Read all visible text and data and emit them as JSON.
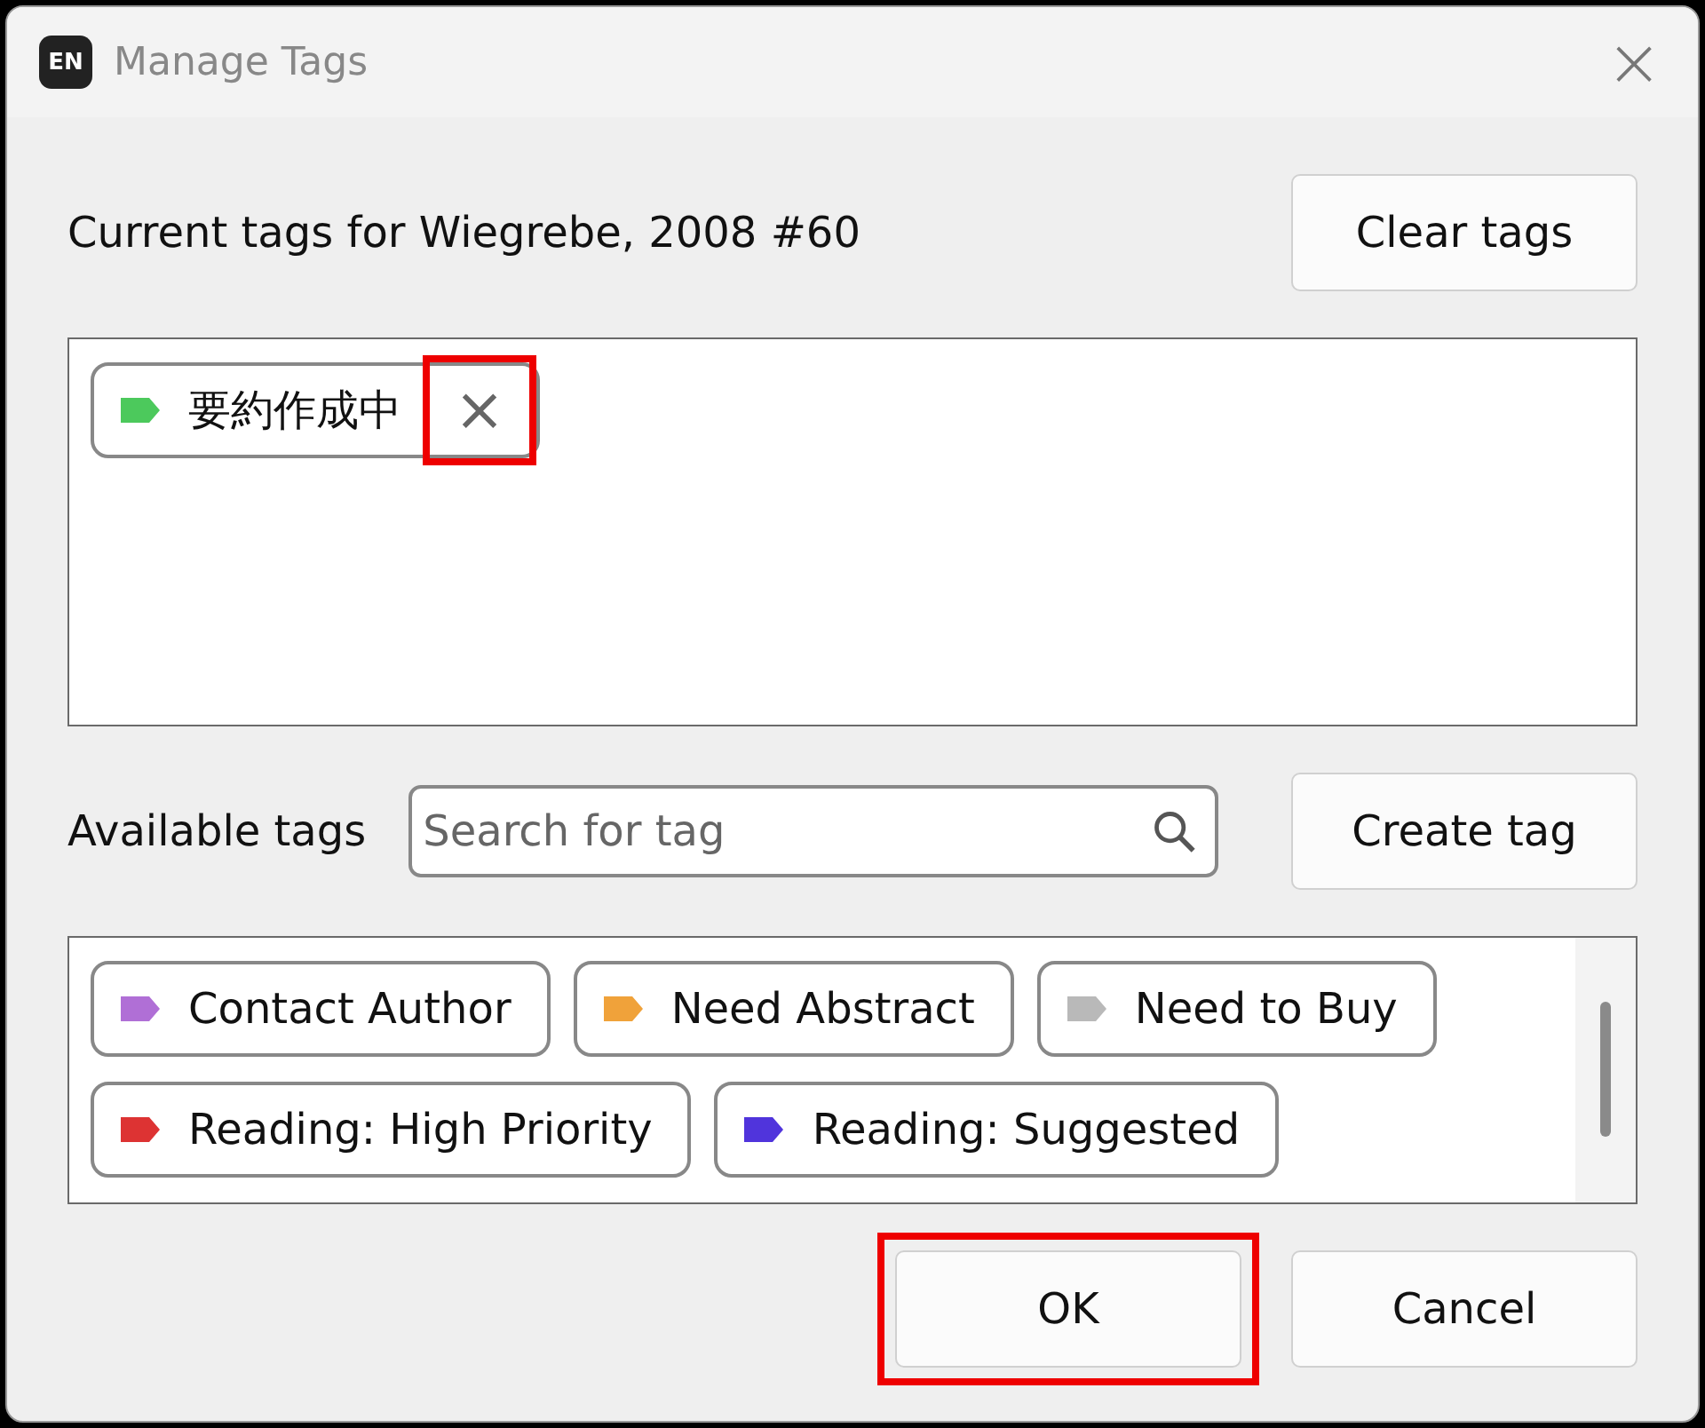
{
  "window": {
    "app_badge": "EN",
    "title": "Manage Tags",
    "close": "×"
  },
  "current": {
    "label": "Current tags for Wiegrebe, 2008 #60",
    "clear_button": "Clear tags",
    "tags": [
      {
        "name": "要約作成中",
        "color": "#4cc95c",
        "remove": "×",
        "highlighted": true
      }
    ]
  },
  "available": {
    "label": "Available tags",
    "search": {
      "placeholder": "Search for tag"
    },
    "create_button": "Create tag",
    "tags": [
      {
        "name": "Contact Author",
        "color": "#b06fd6"
      },
      {
        "name": "Need Abstract",
        "color": "#f0a23a"
      },
      {
        "name": "Need to Buy",
        "color": "#b9b9b9"
      },
      {
        "name": "Reading: High Priority",
        "color": "#dd3333"
      },
      {
        "name": "Reading: Suggested",
        "color": "#5034dc"
      }
    ]
  },
  "buttons": [
    {
      "label": "OK",
      "highlighted": true
    },
    {
      "label": "Cancel",
      "highlighted": false
    }
  ]
}
